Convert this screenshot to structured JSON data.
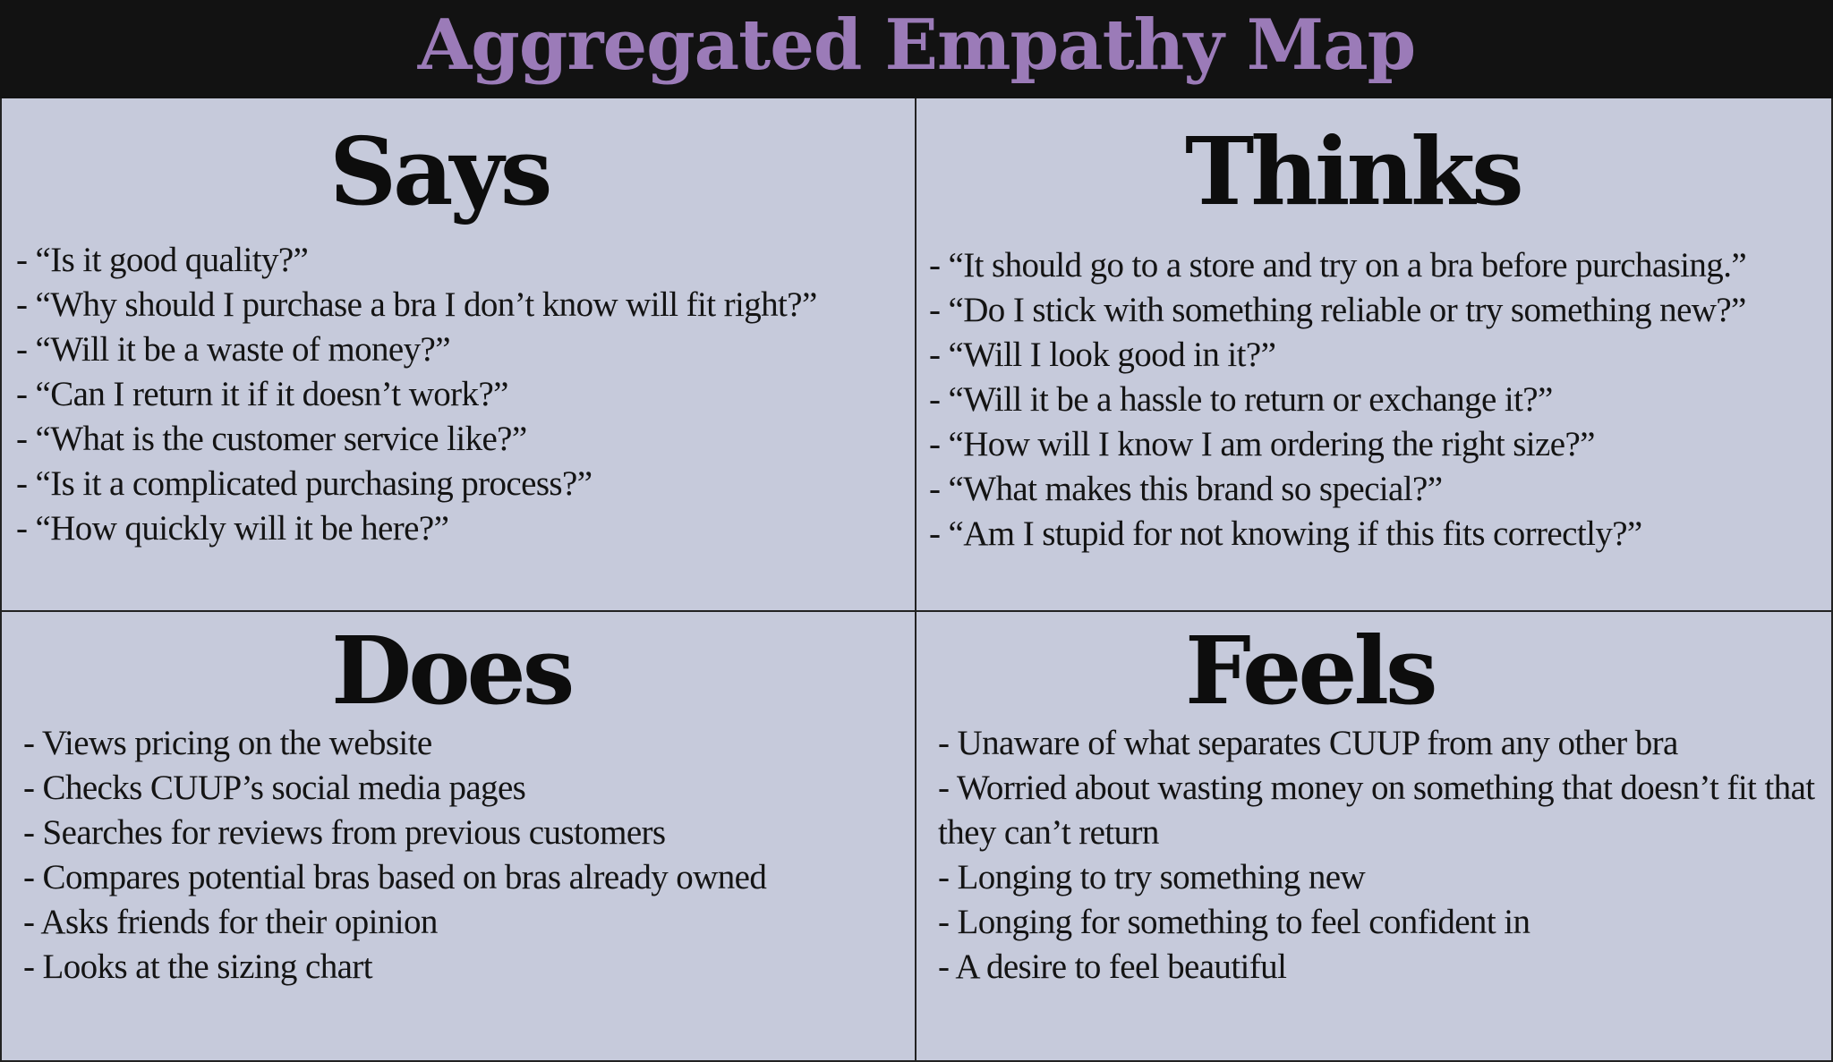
{
  "title": "Aggregated Empathy Map",
  "says": {
    "heading": "Says",
    "items": [
      "- “Is it good quality?”",
      "- “Why should I purchase a bra I don’t know will fit right?”",
      "- “Will it be a waste of money?”",
      "- “Can I return it if it doesn’t work?”",
      "- “What is the customer service like?”",
      "- “Is it a complicated purchasing process?”",
      "- “How quickly will it be here?”"
    ]
  },
  "thinks": {
    "heading": "Thinks",
    "items": [
      " - “It should go to a store and try on a bra before purchasing.”",
      " - “Do I stick with something reliable or try something new?”",
      " - “Will I look good in it?”",
      " - “Will it be a hassle to return or exchange it?”",
      " - “How will I know I am ordering the right size?”",
      " - “What makes this brand so special?”",
      "- “Am I stupid for not knowing if this fits correctly?”"
    ]
  },
  "does": {
    "heading": "Does",
    "items": [
      "- Views pricing on the website",
      "- Checks CUUP’s social media pages",
      "- Searches for reviews from previous customers",
      "- Compares potential bras based on bras already owned",
      "- Asks friends for their opinion",
      "- Looks at the sizing chart"
    ]
  },
  "feels": {
    "heading": "Feels",
    "items": [
      " - Unaware of what separates CUUP from any other bra",
      " - Worried about wasting money on something that doesn’t fit that they can’t return",
      " - Longing to try something new",
      " - Longing for something to feel confident in",
      " - A desire to feel beautiful"
    ]
  },
  "colors": {
    "header_bg": "#121212",
    "title": "#9b7bb8",
    "panel_bg": "#c6cadb",
    "text": "#111111"
  }
}
